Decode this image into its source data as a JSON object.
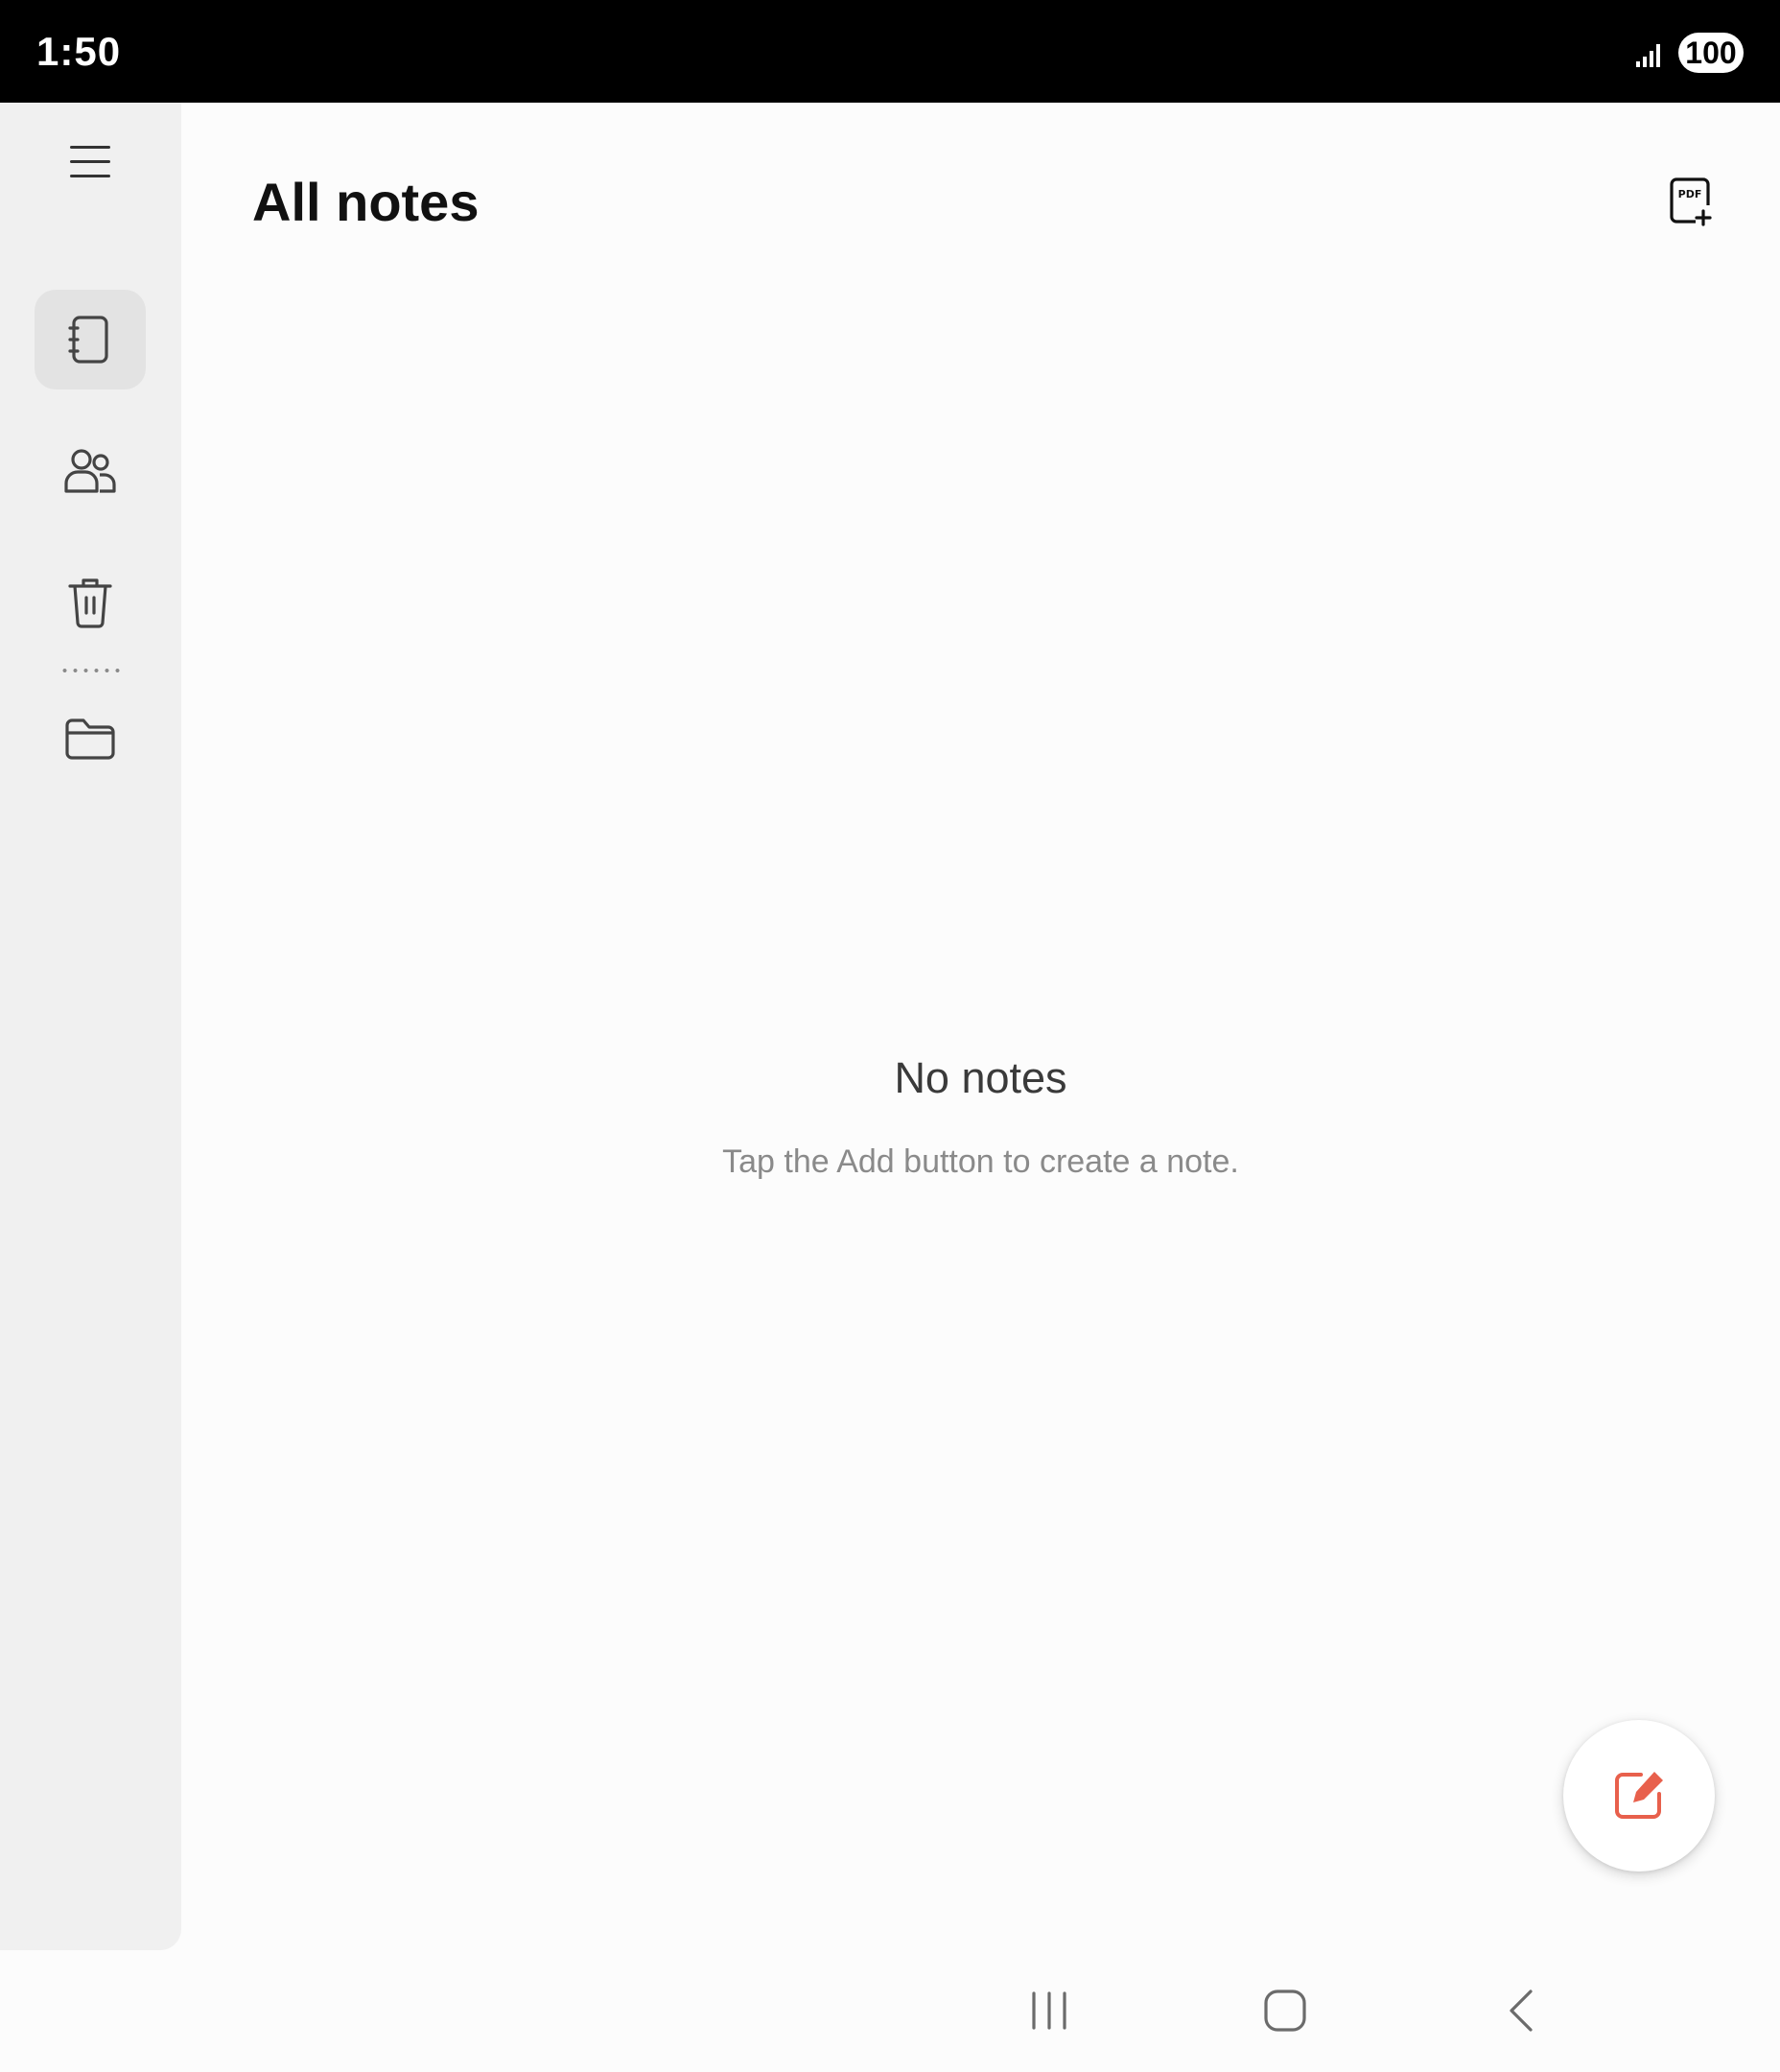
{
  "status_bar": {
    "time": "1:50",
    "battery": "100",
    "signal_icon": "signal-bars-icon"
  },
  "sidebar": {
    "menu_icon": "hamburger-menu-icon",
    "items": [
      {
        "id": "all-notes",
        "icon": "notebook-icon",
        "active": true
      },
      {
        "id": "shared",
        "icon": "people-icon",
        "active": false
      },
      {
        "id": "trash",
        "icon": "trash-icon",
        "active": false
      },
      {
        "id": "folders",
        "icon": "folder-icon",
        "active": false
      }
    ]
  },
  "header": {
    "title": "All notes",
    "import_pdf_icon": "pdf-add-icon"
  },
  "empty_state": {
    "title": "No notes",
    "subtitle": "Tap the Add button to create a note."
  },
  "fab": {
    "icon": "compose-note-icon",
    "accent_color": "#e8604c"
  },
  "nav_bar": {
    "recents_icon": "recents-icon",
    "home_icon": "home-icon",
    "back_icon": "back-icon"
  }
}
